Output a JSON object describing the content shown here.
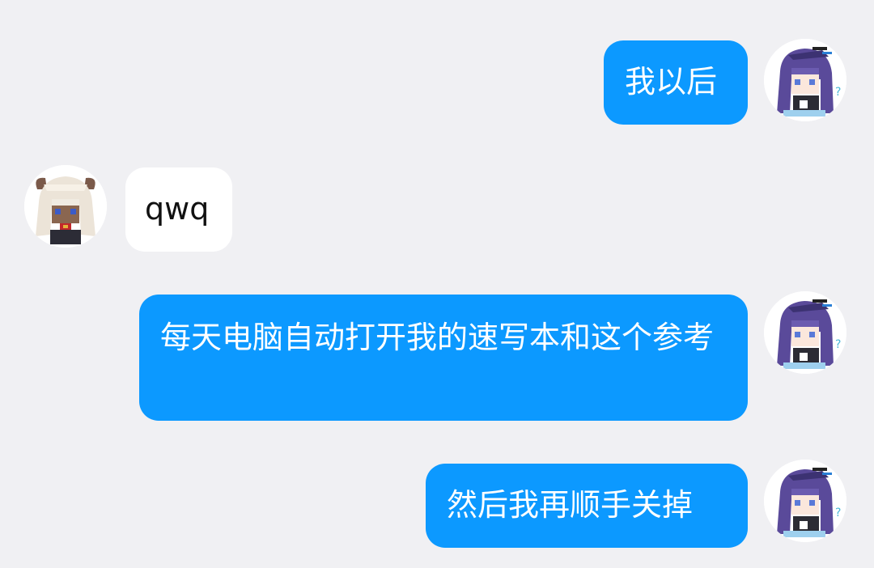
{
  "theme": {
    "background": "#f0f0f3",
    "outgoing_bubble": "#0c99ff",
    "incoming_bubble": "#ffffff",
    "outgoing_text": "#ffffff",
    "incoming_text": "#111111"
  },
  "messages": [
    {
      "direction": "outgoing",
      "text": "我以后",
      "avatar_icon": "self-avatar-icon"
    },
    {
      "direction": "incoming",
      "text": "qwq",
      "avatar_icon": "contact-avatar-icon"
    },
    {
      "direction": "outgoing",
      "text": "每天电脑自动打开我的速写本和这个参考",
      "avatar_icon": "self-avatar-icon"
    },
    {
      "direction": "outgoing",
      "text": "然后我再顺手关掉",
      "avatar_icon": "self-avatar-icon"
    }
  ]
}
